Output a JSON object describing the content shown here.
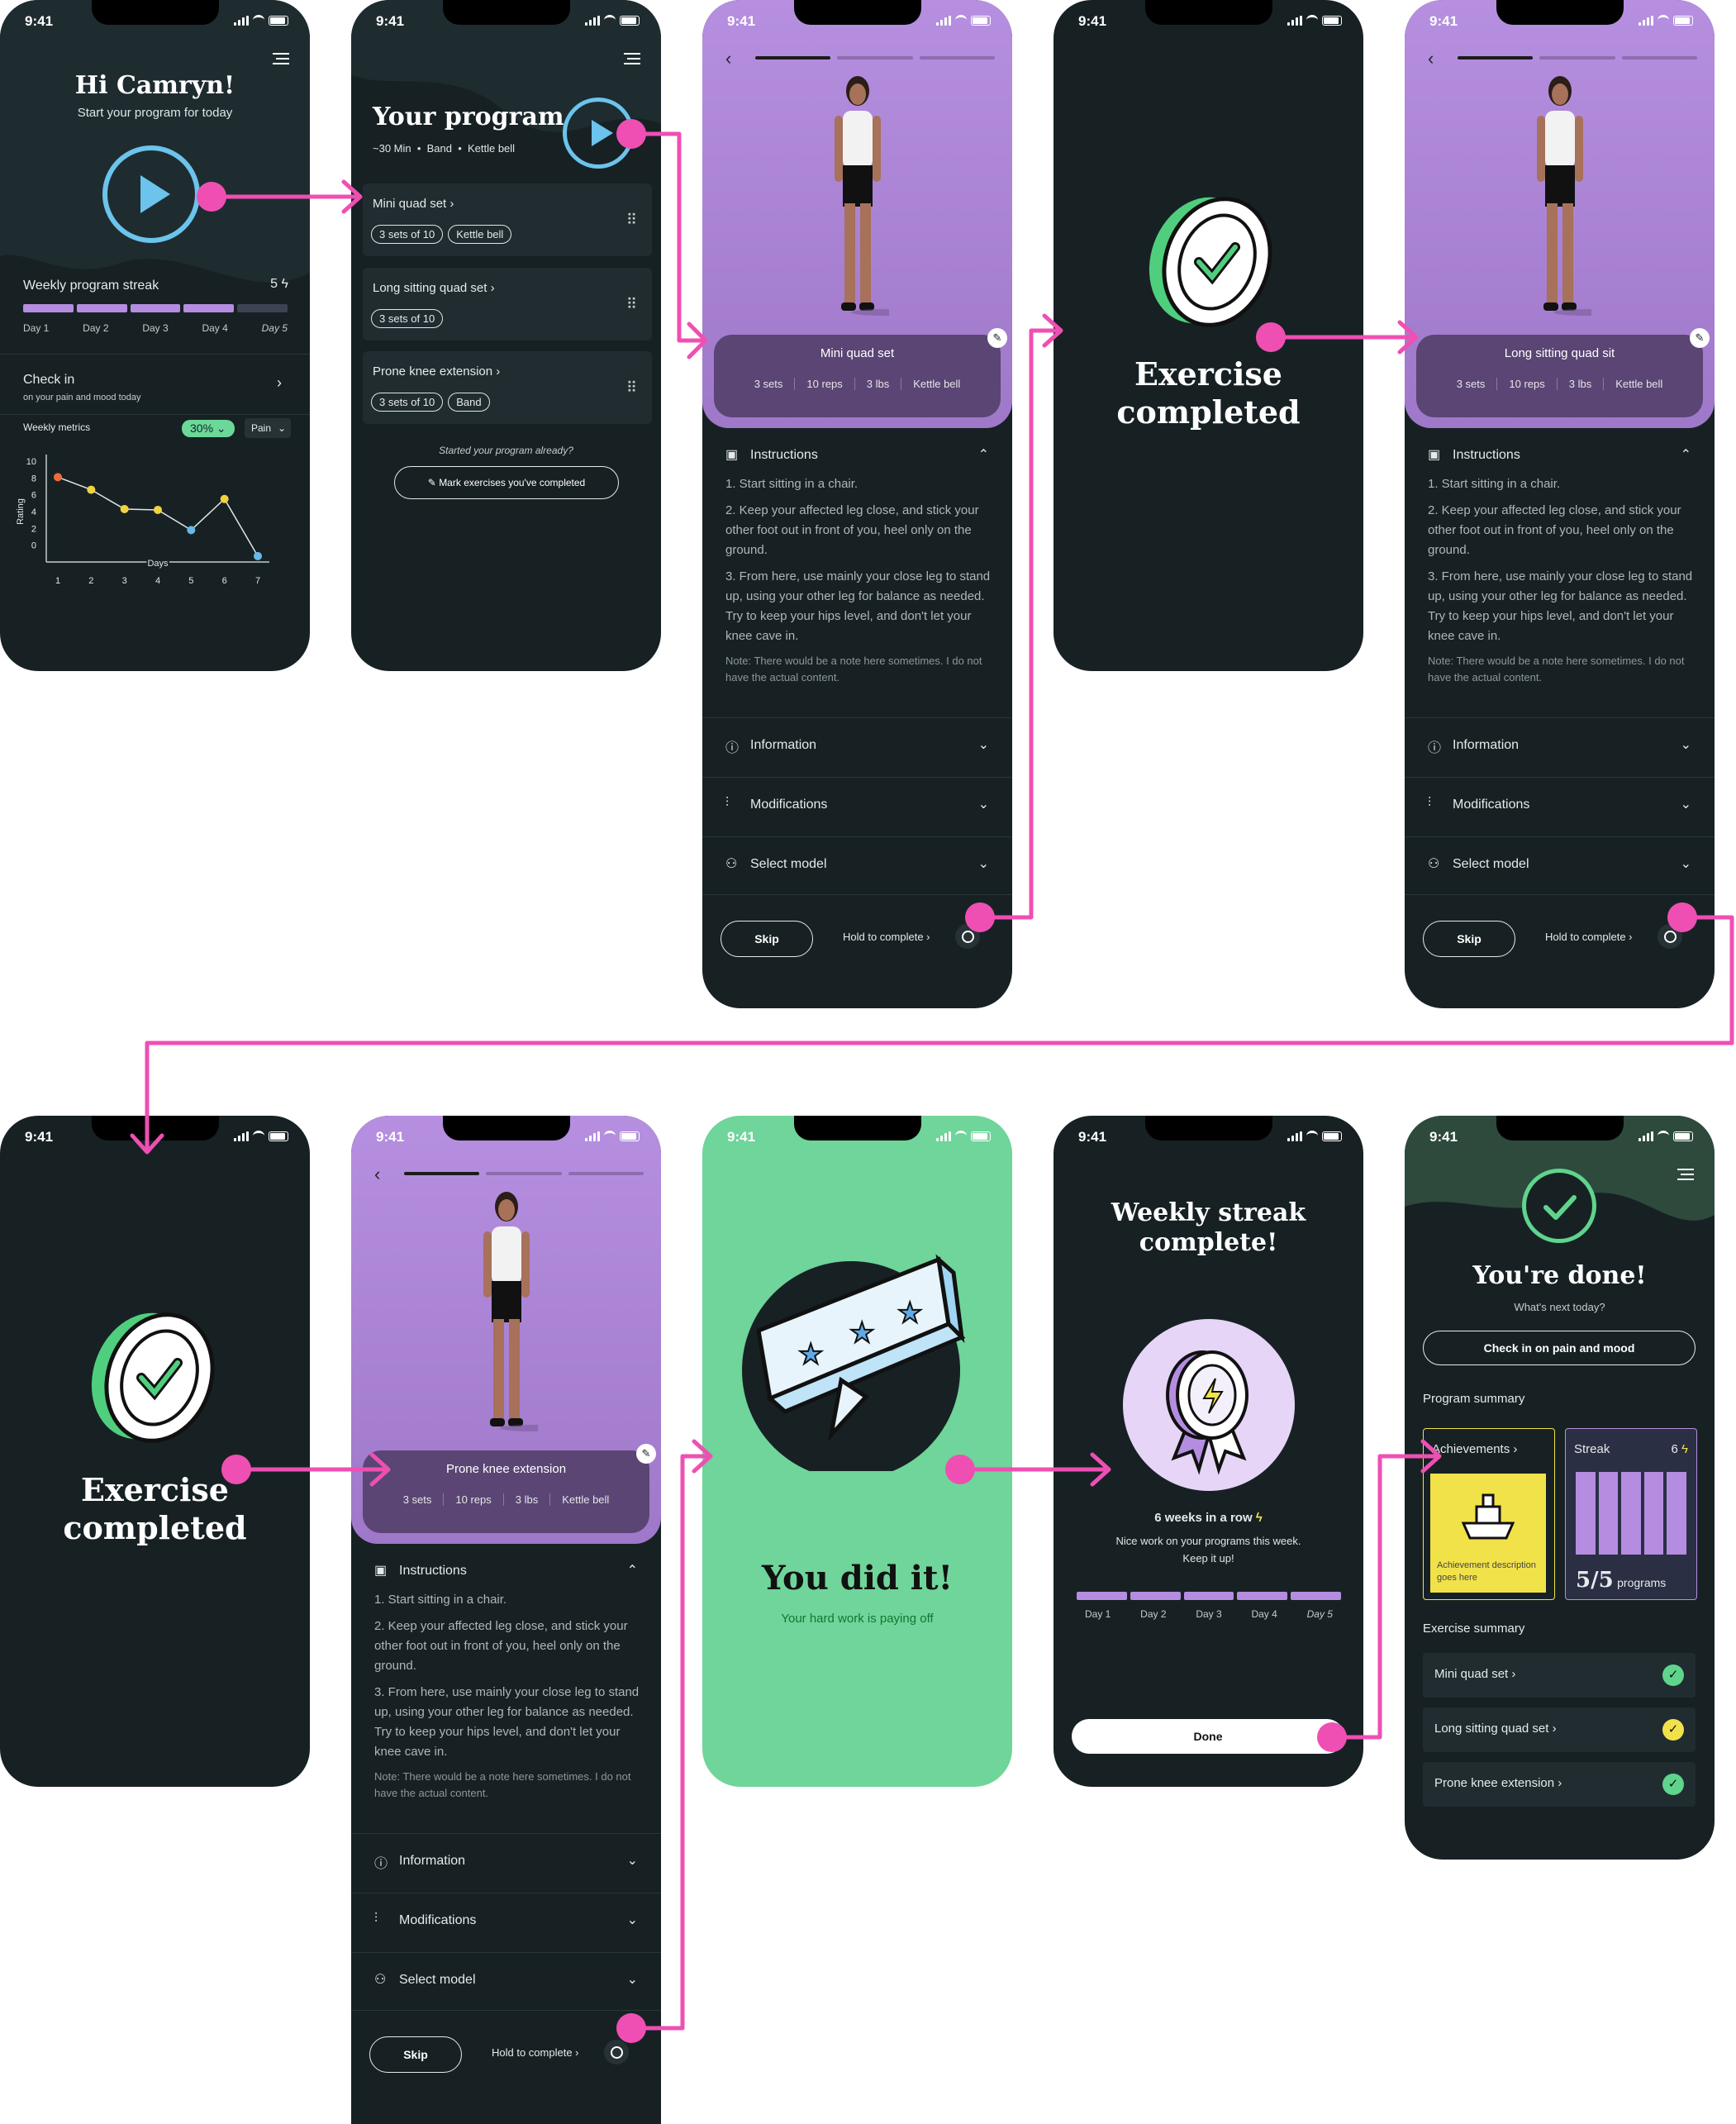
{
  "status_time": "9:41",
  "screen1": {
    "greeting": "Hi Camryn!",
    "subtitle": "Start your program for today",
    "streak_label": "Weekly program streak",
    "streak_count": "5",
    "days": [
      "Day 1",
      "Day 2",
      "Day 3",
      "Day 4",
      "Day 5"
    ],
    "checkin_title": "Check in",
    "checkin_sub": "on your pain and mood today",
    "metrics_label": "Weekly metrics",
    "metrics_badge": "30%",
    "metrics_select": "Pain",
    "chart_data": {
      "type": "line",
      "x": [
        1,
        2,
        3,
        4,
        5,
        6,
        7
      ],
      "values": [
        8.1,
        6.6,
        4.3,
        4.2,
        1.8,
        5.5,
        -1.3
      ],
      "xlabel": "Days",
      "ylabel": "Rating",
      "y_ticks": [
        "10",
        "8",
        "6",
        "4",
        "2",
        "0"
      ],
      "x_ticks": [
        "1",
        "2",
        "3",
        "4",
        "5",
        "6",
        "7"
      ],
      "point_colors": [
        "#f06a3c",
        "#f2d23f",
        "#f2d23f",
        "#f2d23f",
        "#66b9e8",
        "#f2d23f",
        "#66b9e8"
      ]
    }
  },
  "screen2": {
    "title": "Your program",
    "meta": "~30 Min  •  Band  •  Kettle bell",
    "exercises": [
      {
        "name": "Mini quad set",
        "tags": [
          "3 sets of 10",
          "Kettle bell"
        ]
      },
      {
        "name": "Long sitting quad set",
        "tags": [
          "3 sets of 10"
        ]
      },
      {
        "name": "Prone knee extension",
        "tags": [
          "3 sets of 10",
          "Band"
        ]
      }
    ],
    "started_text": "Started your program already?",
    "mark_button": "Mark exercises you've completed"
  },
  "exercise_detail": {
    "instructions_title": "Instructions",
    "steps": [
      "1. Start sitting in a chair.",
      "2. Keep your affected leg close, and stick your other foot out in front of you, heel only on the ground.",
      "3. From here, use mainly your close leg to stand up, using your other leg for balance as needed. Try to keep your hips level, and don't let your knee cave in."
    ],
    "note": "Note: There would be a note here sometimes. I do not have the actual content.",
    "sections": [
      "Information",
      "Modifications",
      "Select model"
    ],
    "skip": "Skip",
    "hold": "Hold to complete",
    "stats": [
      "3 sets",
      "10 reps",
      "3 lbs",
      "Kettle bell"
    ]
  },
  "screen3": {
    "exercise": "Mini quad set"
  },
  "screen5": {
    "exercise": "Long sitting quad sit"
  },
  "screen7": {
    "exercise": "Prone knee extension"
  },
  "completed": {
    "line1": "Exercise",
    "line2": "completed"
  },
  "screen8": {
    "title": "You did it!",
    "subtitle": "Your hard work is paying off"
  },
  "screen9": {
    "title_line1": "Weekly streak",
    "title_line2": "complete!",
    "weeks": "6 weeks in a row",
    "message": "Nice work on your programs this week. Keep it up!",
    "days": [
      "Day 1",
      "Day 2",
      "Day 3",
      "Day 4",
      "Day 5"
    ],
    "done": "Done"
  },
  "screen10": {
    "title": "You're done!",
    "subtitle": "What's next today?",
    "checkin_button": "Check in on pain and mood",
    "program_summary": "Program summary",
    "achievements": "Achievements",
    "achievement_desc": "Achievement description goes here",
    "streak": "Streak",
    "streak_count": "6",
    "programs_count": "5/5",
    "programs_label": "programs",
    "exercise_summary": "Exercise summary",
    "exercises": [
      "Mini quad set",
      "Long sitting quad set",
      "Prone knee extension"
    ],
    "check_colors": [
      "#5fd48c",
      "#f2e24a",
      "#5fd48c"
    ]
  },
  "colors": {
    "accent_pink": "#ef4fb3",
    "purple": "#b68fe0",
    "green": "#6fd59a",
    "dark": "#172124"
  }
}
